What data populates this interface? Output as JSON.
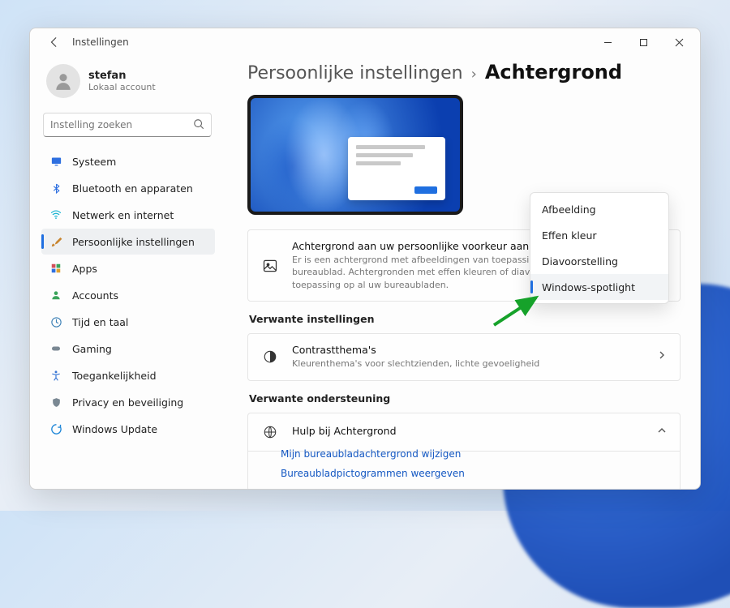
{
  "window": {
    "title": "Instellingen"
  },
  "user": {
    "name": "stefan",
    "subtitle": "Lokaal account"
  },
  "search": {
    "placeholder": "Instelling zoeken"
  },
  "sidebar": {
    "items": [
      {
        "label": "Systeem",
        "icon": "display",
        "color": "#2e6fe0"
      },
      {
        "label": "Bluetooth en apparaten",
        "icon": "bluetooth",
        "color": "#2e6fe0"
      },
      {
        "label": "Netwerk en internet",
        "icon": "wifi",
        "color": "#17b3d1"
      },
      {
        "label": "Persoonlijke instellingen",
        "icon": "brush",
        "color": "#c8852f",
        "selected": true
      },
      {
        "label": "Apps",
        "icon": "apps",
        "color": "#d1505a"
      },
      {
        "label": "Accounts",
        "icon": "person",
        "color": "#3aa35a"
      },
      {
        "label": "Tijd en taal",
        "icon": "globe-clock",
        "color": "#3a7fb5"
      },
      {
        "label": "Gaming",
        "icon": "gamepad",
        "color": "#7a8893"
      },
      {
        "label": "Toegankelijkheid",
        "icon": "accessibility",
        "color": "#3a78d6"
      },
      {
        "label": "Privacy en beveiliging",
        "icon": "shield",
        "color": "#7a8893"
      },
      {
        "label": "Windows Update",
        "icon": "update",
        "color": "#1f87d8"
      }
    ]
  },
  "breadcrumb": {
    "parent": "Persoonlijke instellingen",
    "current": "Achtergrond"
  },
  "personalize_card": {
    "title": "Achtergrond aan uw persoonlijke voorkeur aanpassen",
    "subtitle": "Er is een achtergrond met afbeeldingen van toepassing op het huidige bureaublad. Achtergronden met effen kleuren of diavoorstellingen zijn van toepassing op al uw bureaubladen."
  },
  "dropdown": {
    "options": [
      {
        "label": "Afbeelding"
      },
      {
        "label": "Effen kleur"
      },
      {
        "label": "Diavoorstelling"
      },
      {
        "label": "Windows-spotlight",
        "selected": true
      }
    ]
  },
  "related": {
    "heading": "Verwante instellingen",
    "contrast": {
      "title": "Contrastthema's",
      "subtitle": "Kleurenthema's voor slechtzienden, lichte gevoeligheid"
    }
  },
  "support": {
    "heading": "Verwante ondersteuning",
    "help_title": "Hulp bij Achtergrond",
    "links": [
      "Mijn bureaubladachtergrond wijzigen",
      "Bureaubladpictogrammen weergeven"
    ]
  }
}
